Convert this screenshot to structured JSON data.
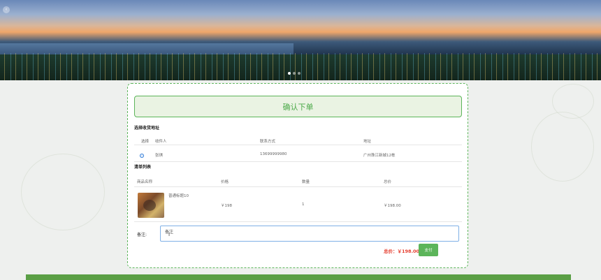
{
  "banner": {
    "arrow": "‹"
  },
  "panel": {
    "confirm_label": "确认下单",
    "address_title": "选择收货地址",
    "address_headers": {
      "select": "选择",
      "name": "收件人",
      "phone": "联系方式",
      "address": "地址"
    },
    "address_row": {
      "name": "张琪",
      "phone": "13699999980",
      "address": "广州珠江新城12栋"
    },
    "list_title": "清单列表",
    "item_headers": {
      "name": "商品名称",
      "price": "价格",
      "qty": "数量",
      "subtotal": "总价"
    },
    "item_row": {
      "name": "普通标题10",
      "price": "￥198",
      "qty": "1",
      "subtotal": "￥198.00"
    },
    "remark_label": "备注:",
    "remark_value": "备注",
    "total_label": "总价：￥198.00",
    "pay_label": "支付"
  },
  "colors": {
    "accent": "#5cb55a",
    "price": "#e53b2c",
    "radio": "#2f7bd8"
  }
}
